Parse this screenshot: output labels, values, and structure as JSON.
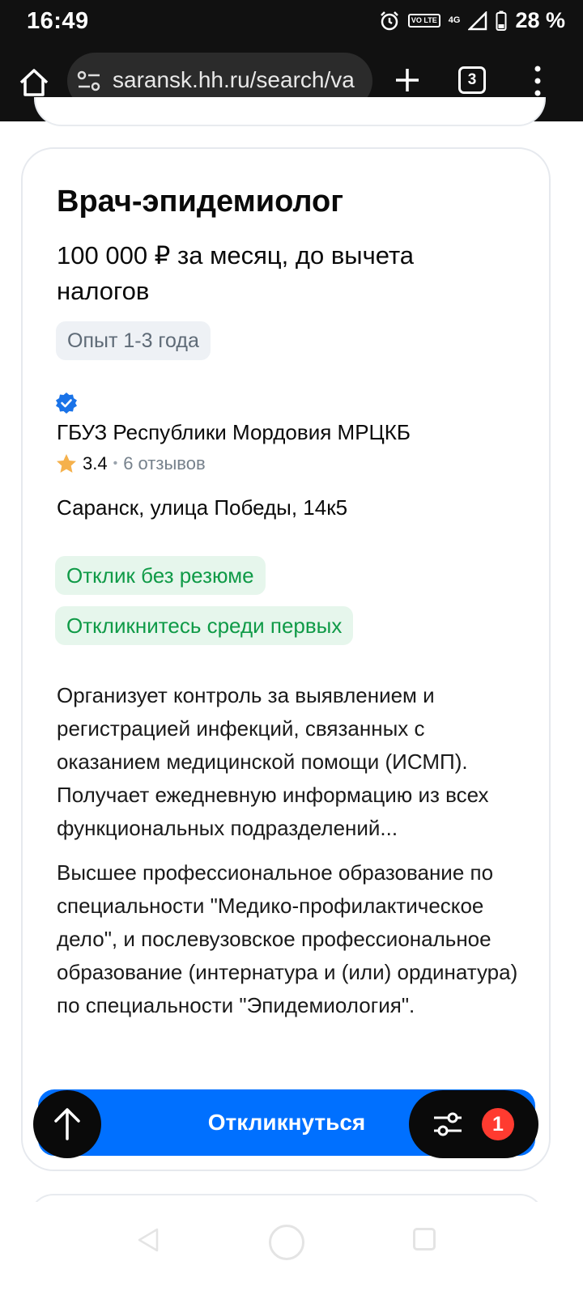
{
  "status_bar": {
    "time": "16:49",
    "network": "4G",
    "volte_label": "VO LTE",
    "battery": "28 %"
  },
  "browser": {
    "url": "saransk.hh.ru/search/va",
    "tab_count": "3"
  },
  "vacancy": {
    "title": "Врач-эпидемиолог",
    "salary": "100 000 ₽ за месяц, до вычета налогов",
    "experience": "Опыт 1-3 года",
    "company": "ГБУЗ Республики Мордовия МРЦКБ",
    "rating": "3.4",
    "reviews": "6 отзывов",
    "address": "Саранск, улица Победы, 14к5",
    "chips": [
      "Отклик без резюме",
      "Откликнитесь среди первых"
    ],
    "description": "Организует контроль за выявлением и регистрацией инфекций, связанных с оказанием медицинской помощи (ИСМП). Получает ежедневную информацию из всех функциональных подразделений...",
    "requirements": "Высшее профессиональное образование по специальности \"Медико-профилактическое дело\", и послевузовское профессиональное образование (интернатура и (или) ординатура) по специальности \"Эпидемиология\".",
    "respond_label": "Откликнуться"
  },
  "filter_badge": "1",
  "colors": {
    "accent": "#0070ff",
    "chip_green_text": "#0f9a47",
    "chip_green_bg": "#e6f6ec",
    "badge": "#ff3b30",
    "verified": "#1a73e8",
    "star": "#f5b14c"
  }
}
